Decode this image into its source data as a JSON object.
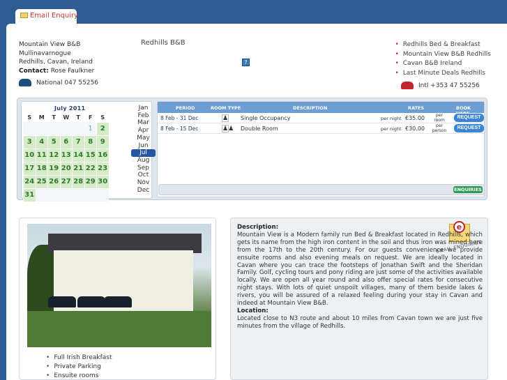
{
  "tab": {
    "label": "Email Enquiry"
  },
  "contact": {
    "lines": [
      "Mountain View B&B",
      "Mullinavarnogue",
      "Redhills, Cavan, Ireland"
    ],
    "contact_label": "Contact:",
    "contact_name": "Rose Faulkner",
    "phone_national": "National 047 55256",
    "phone_intl": "Intl +353 47 55256"
  },
  "title": "Redhills B&B",
  "links": [
    "Redhills Bed & Breakfast",
    "Mountain View B&B Redhills",
    "Cavan B&B Ireland",
    "Last Minute Deals Redhills"
  ],
  "calendar": {
    "title": "July 2011",
    "weekdays": [
      "S",
      "M",
      "T",
      "W",
      "T",
      "F",
      "S"
    ],
    "months": [
      "Jan",
      "Feb",
      "Mar",
      "Apr",
      "May",
      "Jun",
      "Jul",
      "Aug",
      "Sep",
      "Oct",
      "Nov",
      "Dec"
    ],
    "selected_month": "Jul"
  },
  "rates": {
    "headers": {
      "period": "Period",
      "room_type": "Room Type",
      "description": "Description",
      "rates": "Rates",
      "book_here": "Book Here"
    },
    "rows": [
      {
        "period": "8 Feb - 31 Dec",
        "description": "Single Occupancy",
        "unit": "per night",
        "price": "€35.00",
        "per": "per room",
        "button": "REQUEST"
      },
      {
        "period": "8 Feb - 15 Dec",
        "description": "Double Room",
        "unit": "per night",
        "price": "€30.00",
        "per": "per person",
        "button": "REQUEST"
      }
    ],
    "enquiries_label": "ENQUIRIES"
  },
  "features": [
    "Full Irish Breakfast",
    "Private Parking",
    "Ensuite rooms"
  ],
  "description": {
    "heading": "Description:",
    "text": "Mountain View is a Modern family run Bed & Breakfast located in Redhills, which gets its name from the high iron content in the soil and thus iron was mined here from the 17th to the 20th century. For our guests convenience we provide ensuite rooms and also evening meals on request. We are ideally located in Cavan where you can trace the footsteps of Jonathan Swift and the Sheridan Family. Golf, cycling tours and pony riding are just some of the activities available locally. We are open all year round and also offer special rates for consecutive night stays. With lots of quiet unspoilt villages, many of them beside lakes & rivers, you will be assured of a relaxed feeling during your stay in Cavan and indeed at Mountain View B&B.",
    "location_heading": "Location:",
    "location_text": "Located close to N3 route and about 10 miles from Cavan town we are just five minutes from the village of Redhills."
  },
  "email_badge": {
    "letter": "e",
    "caption": "EMAIL ENQUIRIES"
  }
}
